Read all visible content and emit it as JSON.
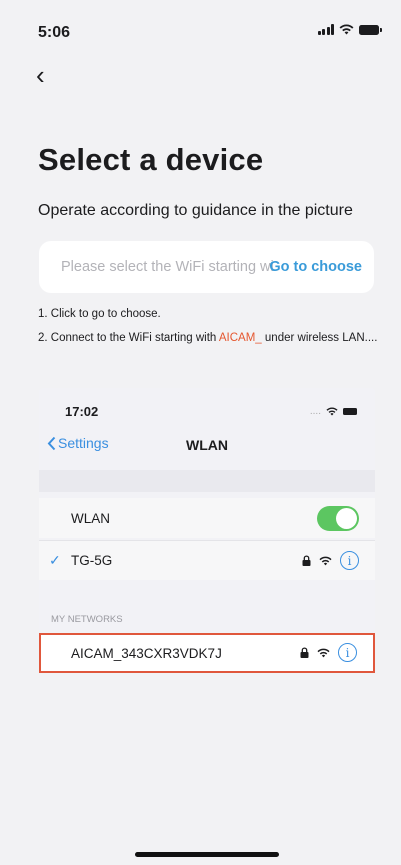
{
  "status_bar": {
    "time": "5:06"
  },
  "nav": {
    "back_icon": "chevron-left-icon",
    "back_glyph": "‹"
  },
  "page": {
    "title": "Select a device",
    "subtitle": "Operate according to guidance in the picture"
  },
  "choose_card": {
    "placeholder": "Please select the WiFi starting with AICAM_",
    "action": "Go to choose"
  },
  "steps": {
    "step1": "1. Click to go to choose.",
    "step2_prefix": "2. Connect to the WiFi starting with ",
    "step2_highlight": "AICAM_",
    "step2_suffix": " under wireless LAN...."
  },
  "guide_screenshot": {
    "time": "17:02",
    "status_dots": "....",
    "back_label": "Settings",
    "title": "WLAN",
    "wlan_row": {
      "label": "WLAN",
      "toggle_on": true
    },
    "connected_row": {
      "check": "✓",
      "label": "TG-5G"
    },
    "section_label": "MY NETWORKS",
    "highlighted_row": {
      "label": "AICAM_343CXR3VDK7J"
    },
    "info_glyph": "i",
    "lock_glyph": "🔒",
    "wifi_glyph": "≋"
  },
  "colors": {
    "accent_blue": "#3a9bd9",
    "highlight_red": "#e5572f",
    "toggle_green": "#5cc661"
  }
}
